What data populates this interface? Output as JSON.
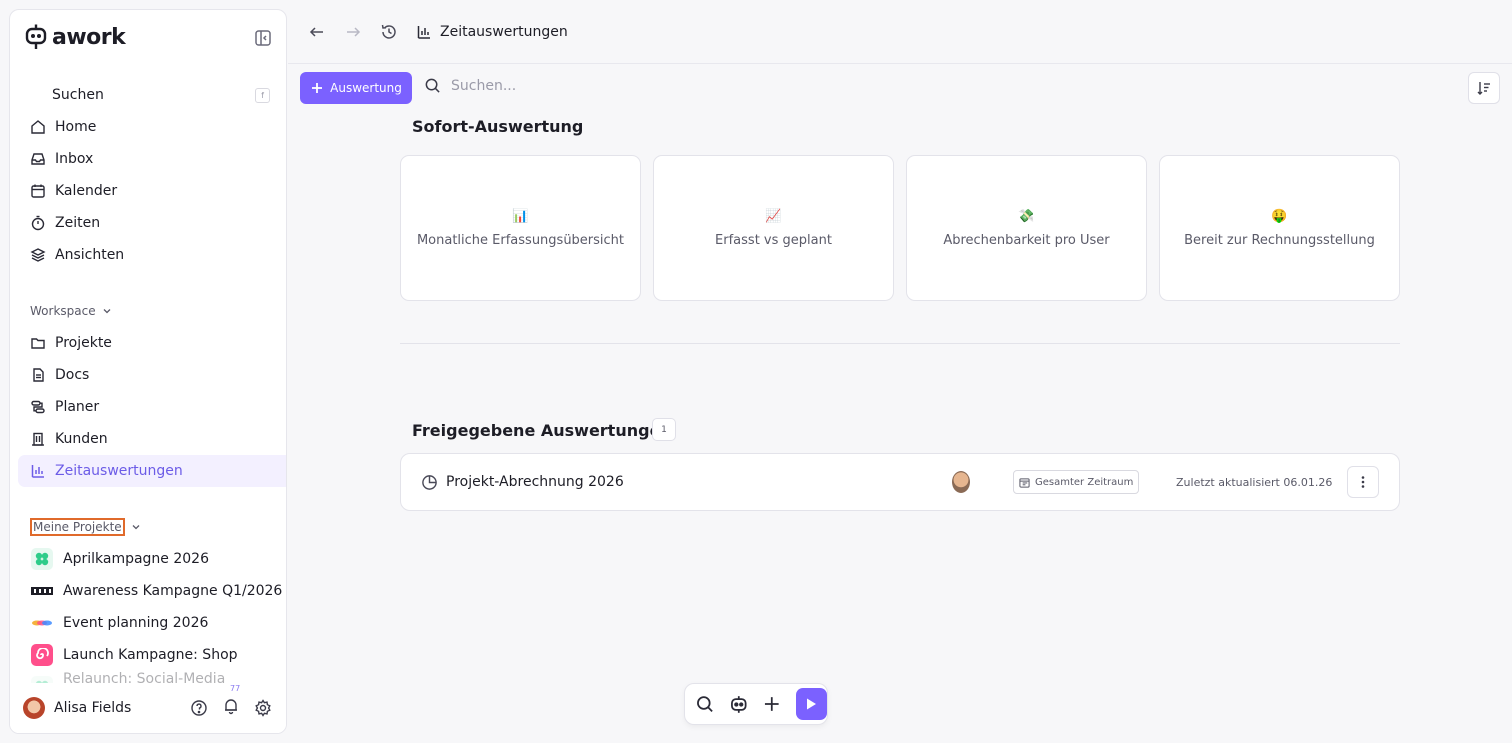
{
  "app": {
    "name": "awork"
  },
  "sidebar": {
    "search_label": "Suchen",
    "search_shortcut": "f",
    "main_items": [
      {
        "label": "Home",
        "icon": "home-icon"
      },
      {
        "label": "Inbox",
        "icon": "inbox-icon"
      },
      {
        "label": "Kalender",
        "icon": "calendar-icon"
      },
      {
        "label": "Zeiten",
        "icon": "timer-icon"
      },
      {
        "label": "Ansichten",
        "icon": "layers-icon"
      }
    ],
    "workspace_label": "Workspace",
    "workspace_items": [
      {
        "label": "Projekte",
        "icon": "folder-icon"
      },
      {
        "label": "Docs",
        "icon": "document-icon"
      },
      {
        "label": "Planer",
        "icon": "planner-icon"
      },
      {
        "label": "Kunden",
        "icon": "building-icon"
      },
      {
        "label": "Zeitauswertungen",
        "icon": "bar-chart-icon",
        "active": true
      }
    ],
    "my_projects_label": "Meine Projekte",
    "projects": [
      {
        "label": "Aprilkampagne 2026",
        "color": "#2ecc8a"
      },
      {
        "label": "Awareness Kampagne Q1/2026",
        "color": "#1d1d26"
      },
      {
        "label": "Event planning 2026",
        "color": "#f5b23c"
      },
      {
        "label": "Launch Kampagne: Shop",
        "color": "#ff4f8b"
      },
      {
        "label": "Relaunch: Social-Media (Sortiment)",
        "color": "#2ecc8a"
      }
    ],
    "user": {
      "name": "Alisa Fields",
      "notifications": "77"
    }
  },
  "topbar": {
    "breadcrumb": "Zeitauswertungen"
  },
  "toolbar": {
    "add_label": "Auswertung",
    "search_placeholder": "Suchen..."
  },
  "instant": {
    "title": "Sofort-Auswertung",
    "cards": [
      {
        "emoji": "📊",
        "label": "Monatliche Erfassungsübersicht"
      },
      {
        "emoji": "📈",
        "label": "Erfasst vs geplant"
      },
      {
        "emoji": "💸",
        "label": "Abrechenbarkeit pro User"
      },
      {
        "emoji": "🤑",
        "label": "Bereit zur Rechnungsstellung"
      }
    ]
  },
  "shared": {
    "title": "Freigegebene Auswertungen",
    "count": "1",
    "reports": [
      {
        "name": "Projekt-Abrechnung 2026",
        "range": "Gesamter Zeitraum",
        "updated": "Zuletzt aktualisiert 06.01.26"
      }
    ]
  }
}
